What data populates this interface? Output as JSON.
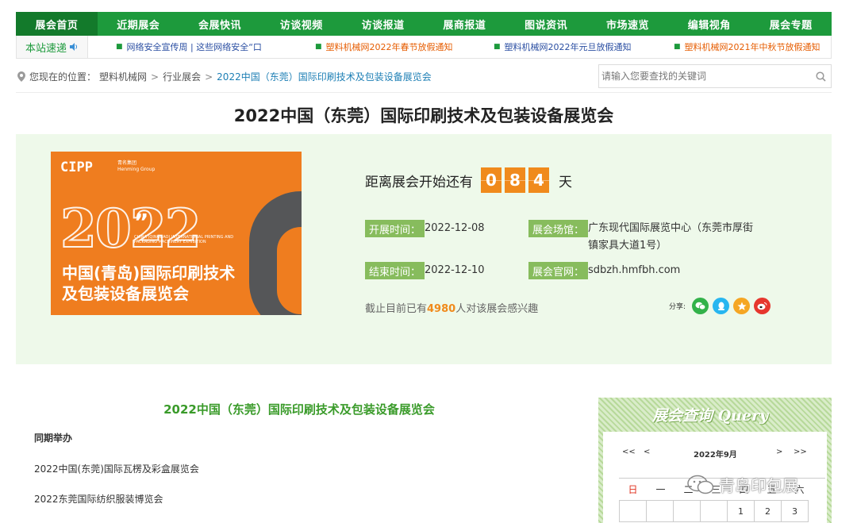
{
  "nav": [
    "展会首页",
    "近期展会",
    "会展快讯",
    "访谈视频",
    "访谈报道",
    "展商报道",
    "图说资讯",
    "市场速览",
    "编辑视角",
    "展会专题"
  ],
  "ticker": {
    "label": "本站速递",
    "items": [
      "网络安全宣传周 | 这些网络安全“口",
      "塑料机械网2022年春节放假通知",
      "塑料机械网2022年元旦放假通知",
      "塑料机械网2021年中秋节放假通知"
    ]
  },
  "breadcrumb": {
    "prefix": "您现在的位置：",
    "items": [
      "塑料机械网",
      "行业展会",
      "2022中国（东莞）国际印刷技术及包装设备展览会"
    ]
  },
  "search": {
    "placeholder": "请输入您要查找的关键词"
  },
  "page_title": "2022中国（东莞）国际印刷技术及包装设备展览会",
  "poster": {
    "brand": "CIPP",
    "brand_group": "青名集团",
    "brand_group_en": "Henming Group",
    "year": "2022",
    "sub_en": "CHINA (QINGDAO) INTERNATIONAL PRINTING AND PACKAGING MACHINERY EXHIBITION",
    "sub_cn_1": "中国(青岛)国际印刷技术",
    "sub_cn_2": "及包装设备展览会"
  },
  "countdown": {
    "prefix": "距离展会开始还有",
    "digits": [
      "0",
      "8",
      "4"
    ],
    "suffix": "天"
  },
  "details": {
    "start_label": "开展时间：",
    "start": "2022-12-08",
    "end_label": "结束时间：",
    "end": "2022-12-10",
    "venue_label": "展会场馆：",
    "venue": "广东现代国际展览中心（东莞市厚街镇家具大道1号）",
    "site_label": "展会官网：",
    "site": "sdbzh.hmfbh.com"
  },
  "interest": {
    "before": "截止目前已有",
    "count": "4980",
    "after": "人对该展会感兴趣"
  },
  "share": {
    "label": "分享:"
  },
  "article": {
    "title": "2022中国（东莞）国际印刷技术及包装设备展览会",
    "heading": "同期举办",
    "items": [
      "2022中国(东莞)国际瓦楞及彩盒展览会",
      "2022东莞国际纺织服装博览会"
    ]
  },
  "query": {
    "title": "展会查询 Query",
    "prev_year": "<<",
    "prev_month": "<",
    "month": "2022年9月",
    "next_month": ">",
    "next_year": ">>",
    "week": [
      "日",
      "一",
      "二",
      "三",
      "四",
      "五",
      "六"
    ],
    "row1": [
      "",
      "",
      "",
      "",
      "1",
      "2",
      "3"
    ]
  },
  "watermark": "青岛印包展",
  "colors": {
    "green": "#1d9a3c",
    "orange": "#f08a1c",
    "label_green": "#87bc5d"
  }
}
